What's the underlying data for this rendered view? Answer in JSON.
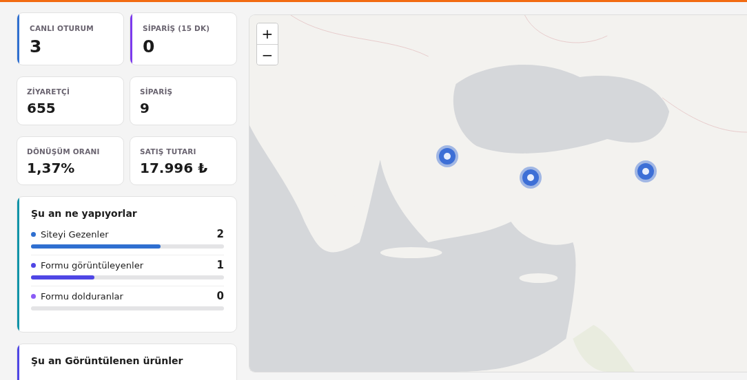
{
  "stats": [
    {
      "label": "CANLI OTURUM",
      "value": "3",
      "color": "#2f6fd0"
    },
    {
      "label": "SİPARİŞ (15 DK)",
      "value": "0",
      "color": "#7c3aed"
    },
    {
      "label": "ZİYARETÇİ",
      "value": "655"
    },
    {
      "label": "SİPARİŞ",
      "value": "9"
    },
    {
      "label": "DÖNÜŞÜM ORANI",
      "value": "1,37%"
    },
    {
      "label": "SATIŞ TUTARI",
      "value": "17.996 ₺"
    }
  ],
  "activity": {
    "title": "Şu an ne yapıyorlar",
    "color": "#0e93a8",
    "items": [
      {
        "label": "Siteyi Gezenler",
        "count": "2",
        "level": 0.67,
        "color": "#2f6fd0"
      },
      {
        "label": "Formu görüntüleyenler",
        "count": "1",
        "level": 0.33,
        "color": "#4f46e5"
      },
      {
        "label": "Formu dolduranlar",
        "count": "0",
        "level": 0,
        "color": "#8b5cf6"
      }
    ]
  },
  "products": {
    "title": "Şu an Görüntülenen ürünler",
    "color": "#4f46e5"
  },
  "map": {
    "zoom_in": "+",
    "zoom_out": "−"
  }
}
